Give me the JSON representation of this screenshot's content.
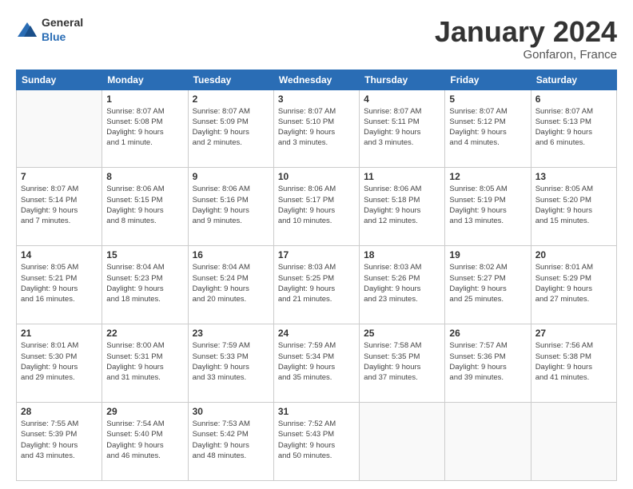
{
  "header": {
    "logo": {
      "general": "General",
      "blue": "Blue"
    },
    "title": "January 2024",
    "location": "Gonfaron, France"
  },
  "days_of_week": [
    "Sunday",
    "Monday",
    "Tuesday",
    "Wednesday",
    "Thursday",
    "Friday",
    "Saturday"
  ],
  "weeks": [
    [
      {
        "day": "",
        "info": ""
      },
      {
        "day": "1",
        "info": "Sunrise: 8:07 AM\nSunset: 5:08 PM\nDaylight: 9 hours\nand 1 minute."
      },
      {
        "day": "2",
        "info": "Sunrise: 8:07 AM\nSunset: 5:09 PM\nDaylight: 9 hours\nand 2 minutes."
      },
      {
        "day": "3",
        "info": "Sunrise: 8:07 AM\nSunset: 5:10 PM\nDaylight: 9 hours\nand 3 minutes."
      },
      {
        "day": "4",
        "info": "Sunrise: 8:07 AM\nSunset: 5:11 PM\nDaylight: 9 hours\nand 3 minutes."
      },
      {
        "day": "5",
        "info": "Sunrise: 8:07 AM\nSunset: 5:12 PM\nDaylight: 9 hours\nand 4 minutes."
      },
      {
        "day": "6",
        "info": "Sunrise: 8:07 AM\nSunset: 5:13 PM\nDaylight: 9 hours\nand 6 minutes."
      }
    ],
    [
      {
        "day": "7",
        "info": "Sunrise: 8:07 AM\nSunset: 5:14 PM\nDaylight: 9 hours\nand 7 minutes."
      },
      {
        "day": "8",
        "info": "Sunrise: 8:06 AM\nSunset: 5:15 PM\nDaylight: 9 hours\nand 8 minutes."
      },
      {
        "day": "9",
        "info": "Sunrise: 8:06 AM\nSunset: 5:16 PM\nDaylight: 9 hours\nand 9 minutes."
      },
      {
        "day": "10",
        "info": "Sunrise: 8:06 AM\nSunset: 5:17 PM\nDaylight: 9 hours\nand 10 minutes."
      },
      {
        "day": "11",
        "info": "Sunrise: 8:06 AM\nSunset: 5:18 PM\nDaylight: 9 hours\nand 12 minutes."
      },
      {
        "day": "12",
        "info": "Sunrise: 8:05 AM\nSunset: 5:19 PM\nDaylight: 9 hours\nand 13 minutes."
      },
      {
        "day": "13",
        "info": "Sunrise: 8:05 AM\nSunset: 5:20 PM\nDaylight: 9 hours\nand 15 minutes."
      }
    ],
    [
      {
        "day": "14",
        "info": "Sunrise: 8:05 AM\nSunset: 5:21 PM\nDaylight: 9 hours\nand 16 minutes."
      },
      {
        "day": "15",
        "info": "Sunrise: 8:04 AM\nSunset: 5:23 PM\nDaylight: 9 hours\nand 18 minutes."
      },
      {
        "day": "16",
        "info": "Sunrise: 8:04 AM\nSunset: 5:24 PM\nDaylight: 9 hours\nand 20 minutes."
      },
      {
        "day": "17",
        "info": "Sunrise: 8:03 AM\nSunset: 5:25 PM\nDaylight: 9 hours\nand 21 minutes."
      },
      {
        "day": "18",
        "info": "Sunrise: 8:03 AM\nSunset: 5:26 PM\nDaylight: 9 hours\nand 23 minutes."
      },
      {
        "day": "19",
        "info": "Sunrise: 8:02 AM\nSunset: 5:27 PM\nDaylight: 9 hours\nand 25 minutes."
      },
      {
        "day": "20",
        "info": "Sunrise: 8:01 AM\nSunset: 5:29 PM\nDaylight: 9 hours\nand 27 minutes."
      }
    ],
    [
      {
        "day": "21",
        "info": "Sunrise: 8:01 AM\nSunset: 5:30 PM\nDaylight: 9 hours\nand 29 minutes."
      },
      {
        "day": "22",
        "info": "Sunrise: 8:00 AM\nSunset: 5:31 PM\nDaylight: 9 hours\nand 31 minutes."
      },
      {
        "day": "23",
        "info": "Sunrise: 7:59 AM\nSunset: 5:33 PM\nDaylight: 9 hours\nand 33 minutes."
      },
      {
        "day": "24",
        "info": "Sunrise: 7:59 AM\nSunset: 5:34 PM\nDaylight: 9 hours\nand 35 minutes."
      },
      {
        "day": "25",
        "info": "Sunrise: 7:58 AM\nSunset: 5:35 PM\nDaylight: 9 hours\nand 37 minutes."
      },
      {
        "day": "26",
        "info": "Sunrise: 7:57 AM\nSunset: 5:36 PM\nDaylight: 9 hours\nand 39 minutes."
      },
      {
        "day": "27",
        "info": "Sunrise: 7:56 AM\nSunset: 5:38 PM\nDaylight: 9 hours\nand 41 minutes."
      }
    ],
    [
      {
        "day": "28",
        "info": "Sunrise: 7:55 AM\nSunset: 5:39 PM\nDaylight: 9 hours\nand 43 minutes."
      },
      {
        "day": "29",
        "info": "Sunrise: 7:54 AM\nSunset: 5:40 PM\nDaylight: 9 hours\nand 46 minutes."
      },
      {
        "day": "30",
        "info": "Sunrise: 7:53 AM\nSunset: 5:42 PM\nDaylight: 9 hours\nand 48 minutes."
      },
      {
        "day": "31",
        "info": "Sunrise: 7:52 AM\nSunset: 5:43 PM\nDaylight: 9 hours\nand 50 minutes."
      },
      {
        "day": "",
        "info": ""
      },
      {
        "day": "",
        "info": ""
      },
      {
        "day": "",
        "info": ""
      }
    ]
  ]
}
